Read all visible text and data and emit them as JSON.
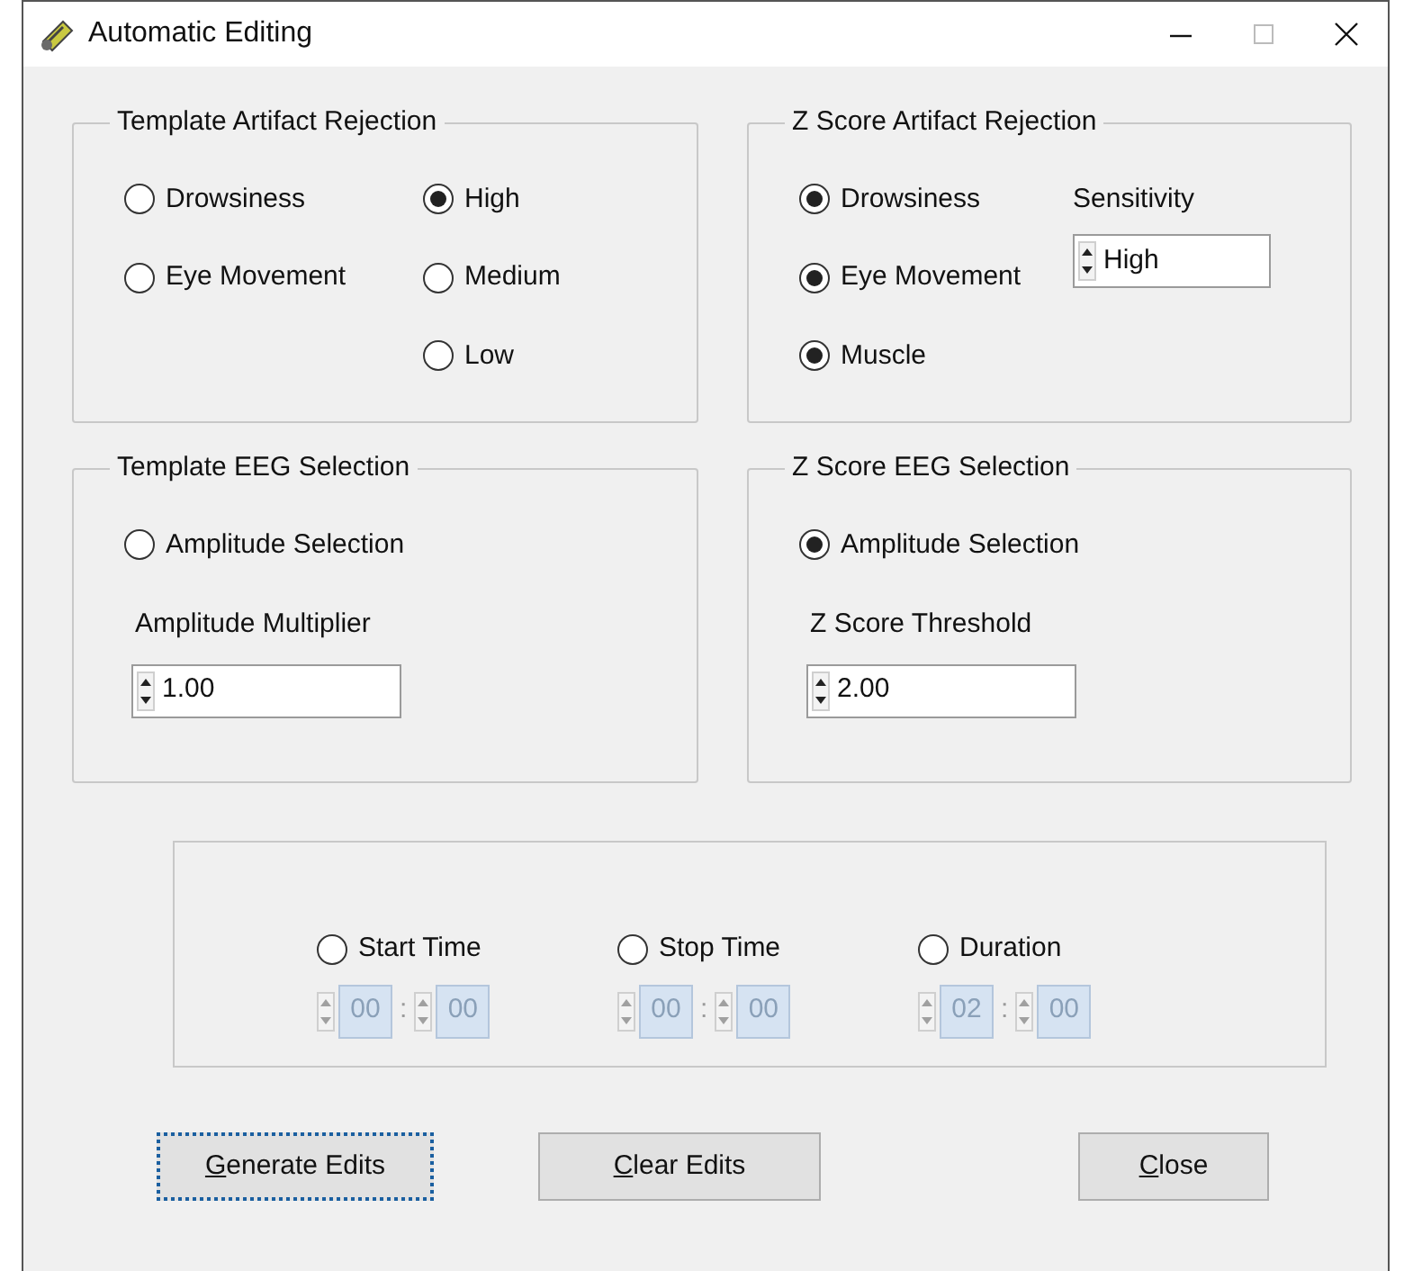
{
  "window": {
    "title": "Automatic Editing"
  },
  "template_artifact_rejection": {
    "title": "Template Artifact Rejection",
    "types": [
      {
        "label": "Drowsiness",
        "selected": false
      },
      {
        "label": "Eye Movement",
        "selected": false
      }
    ],
    "levels": [
      {
        "label": "High",
        "selected": true
      },
      {
        "label": "Medium",
        "selected": false
      },
      {
        "label": "Low",
        "selected": false
      }
    ]
  },
  "z_score_artifact_rejection": {
    "title": "Z Score Artifact Rejection",
    "types": [
      {
        "label": "Drowsiness",
        "selected": true
      },
      {
        "label": "Eye Movement",
        "selected": true
      },
      {
        "label": "Muscle",
        "selected": true
      }
    ],
    "sensitivity": {
      "label": "Sensitivity",
      "value": "High"
    }
  },
  "template_eeg_selection": {
    "title": "Template EEG Selection",
    "option": {
      "label": "Amplitude Selection",
      "selected": false
    },
    "field": {
      "label": "Amplitude Multiplier",
      "value": "1.00"
    }
  },
  "z_score_eeg_selection": {
    "title": "Z Score EEG Selection",
    "option": {
      "label": "Amplitude Selection",
      "selected": true
    },
    "field": {
      "label": "Z Score Threshold",
      "value": "2.00"
    }
  },
  "time_options": [
    {
      "label": "Start Time",
      "selected": false,
      "disabled": true,
      "first": "00",
      "separator": ":",
      "second": "00"
    },
    {
      "label": "Stop Time",
      "selected": false,
      "disabled": true,
      "first": "00",
      "separator": ":",
      "second": "00"
    },
    {
      "label": "Duration",
      "selected": false,
      "disabled": true,
      "first": "02",
      "separator": ":",
      "second": "00"
    }
  ],
  "buttons": [
    {
      "label": "Generate Edits",
      "underline_first": true,
      "focused": true
    },
    {
      "label": "Clear Edits",
      "underline_first": true,
      "focused": false
    },
    {
      "label": "Close",
      "underline_first": true,
      "focused": false
    }
  ]
}
